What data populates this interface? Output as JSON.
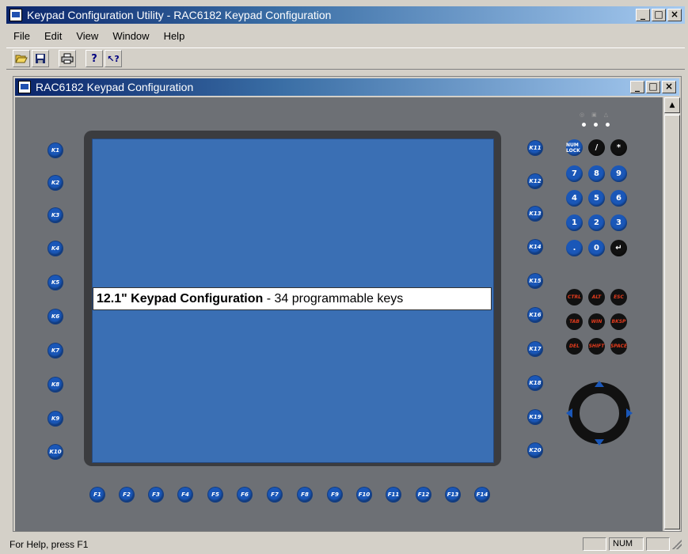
{
  "window": {
    "title": "Keypad Configuration Utility - RAC6182 Keypad Configuration",
    "controls": [
      "_",
      "□",
      "×"
    ]
  },
  "menu": [
    "File",
    "Edit",
    "View",
    "Window",
    "Help"
  ],
  "toolbar": {
    "buttons": [
      "open-icon",
      "save-icon",
      "print-icon",
      "help-icon",
      "context-help-icon"
    ]
  },
  "child_window": {
    "title": "RAC6182 Keypad Configuration",
    "controls": [
      "_",
      "□",
      "×"
    ]
  },
  "keypad": {
    "label_bold": "12.1\" Keypad Configuration",
    "label_rest": " - 34 programmable keys",
    "left_keys": [
      "K1",
      "K2",
      "K3",
      "K4",
      "K5",
      "K6",
      "K7",
      "K8",
      "K9",
      "K10"
    ],
    "right_keys": [
      "K11",
      "K12",
      "K13",
      "K14",
      "K15",
      "K16",
      "K17",
      "K18",
      "K19",
      "K20"
    ],
    "function_keys": [
      "F1",
      "F2",
      "F3",
      "F4",
      "F5",
      "F6",
      "F7",
      "F8",
      "F9",
      "F10",
      "F11",
      "F12",
      "F13",
      "F14"
    ],
    "numpad_top": [
      "NUM LOCK",
      "/",
      "*"
    ],
    "numpad_rows": [
      [
        "7",
        "8",
        "9"
      ],
      [
        "4",
        "5",
        "6"
      ],
      [
        "1",
        "2",
        "3"
      ],
      [
        ".",
        "0",
        "↵"
      ]
    ],
    "control_keys": [
      [
        "CTRL",
        "ALT",
        "ESC"
      ],
      [
        "TAB",
        "WIN",
        "BKSP"
      ],
      [
        "DEL",
        "SHIFT",
        "SPACE"
      ]
    ],
    "accent": "#1a57b8",
    "screen_color": "#3a6fb4"
  },
  "statusbar": {
    "text": "For Help, press F1",
    "num": "NUM"
  }
}
